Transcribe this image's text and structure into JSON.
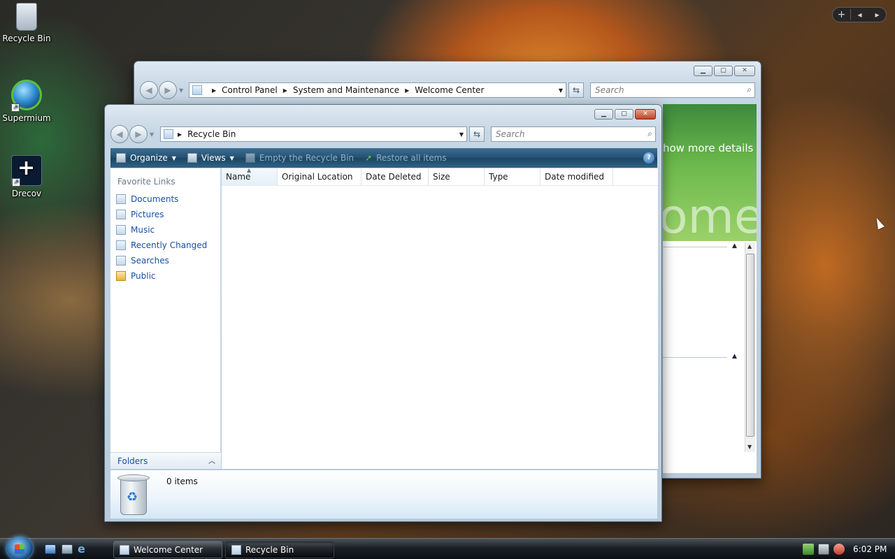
{
  "desktop": {
    "icons": [
      {
        "label": "Recycle Bin"
      },
      {
        "label": "Supermium"
      },
      {
        "label": "Drecov"
      }
    ]
  },
  "welcome_window": {
    "address": [
      "Control Panel",
      "System and Maintenance",
      "Welcome Center"
    ],
    "search_placeholder": "Search",
    "details_link": "how more details",
    "banner_text": "ome"
  },
  "recycle_window": {
    "address": [
      "Recycle Bin"
    ],
    "search_placeholder": "Search",
    "toolbar": {
      "organize": "Organize",
      "views": "Views",
      "empty": "Empty the Recycle Bin",
      "restore": "Restore all items",
      "help": "?"
    },
    "favorites_title": "Favorite Links",
    "favorites": [
      {
        "label": "Documents",
        "icon": "documents-icon"
      },
      {
        "label": "Pictures",
        "icon": "pictures-icon"
      },
      {
        "label": "Music",
        "icon": "music-icon"
      },
      {
        "label": "Recently Changed",
        "icon": "recently-changed-icon"
      },
      {
        "label": "Searches",
        "icon": "searches-icon"
      },
      {
        "label": "Public",
        "icon": "folder-icon"
      }
    ],
    "folders_label": "Folders",
    "columns": [
      "Name",
      "Original Location",
      "Date Deleted",
      "Size",
      "Type",
      "Date modified"
    ],
    "items_count": "0 items"
  },
  "taskbar": {
    "buttons": [
      {
        "label": "Welcome Center",
        "active": false
      },
      {
        "label": "Recycle Bin",
        "active": true
      }
    ],
    "clock": "6:02 PM"
  }
}
